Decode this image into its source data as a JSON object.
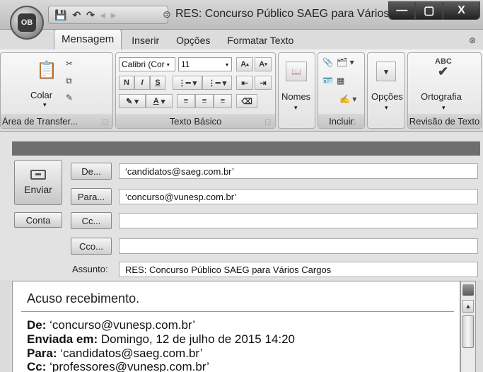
{
  "window": {
    "title": "RES: Concurso Público SAEG para Vários ...",
    "min_symbol": "—",
    "max_symbol": "▢",
    "close_symbol": "X"
  },
  "office_button": {
    "logo": "OB"
  },
  "tabs": [
    {
      "label": "Mensagem",
      "active": true
    },
    {
      "label": "Inserir"
    },
    {
      "label": "Opções"
    },
    {
      "label": "Formatar Texto"
    }
  ],
  "ribbon": {
    "clipboard": {
      "paste_label": "Colar",
      "group_label": "Área de Transfer..."
    },
    "basic_text": {
      "font_name": "Calibri (Cor",
      "font_size": "11",
      "group_label": "Texto Básico"
    },
    "names": {
      "label": "Nomes"
    },
    "include": {
      "group_label": "Incluir"
    },
    "options": {
      "label": "Opções"
    },
    "proofing": {
      "label": "Ortografia",
      "group_label": "Revisão de Texto",
      "icon_text": "ABC"
    }
  },
  "compose": {
    "send_label": "Enviar",
    "account_label": "Conta",
    "from_label": "De...",
    "to_label": "Para...",
    "cc_label": "Cc...",
    "bcc_label": "Cco...",
    "subject_label": "Assunto:",
    "from_value": "‘candidatos@saeg.com.br’",
    "to_value": "‘concurso@vunesp.com.br’",
    "cc_value": "",
    "bcc_value": "",
    "subject_value": "RES: Concurso Público SAEG para Vários Cargos"
  },
  "body": {
    "greeting": "Acuso recebimento.",
    "from_key": "De:",
    "from_val": " ‘concurso@vunesp.com.br’",
    "sent_key": "Enviada em:",
    "sent_val": " Domingo, 12 de julho de 2015  14:20",
    "to_key": "Para:",
    "to_val": " ‘candidatos@saeg.com.br’",
    "cc_key": "Cc:",
    "cc_val": " ‘professores@vunesp.com.br’"
  }
}
